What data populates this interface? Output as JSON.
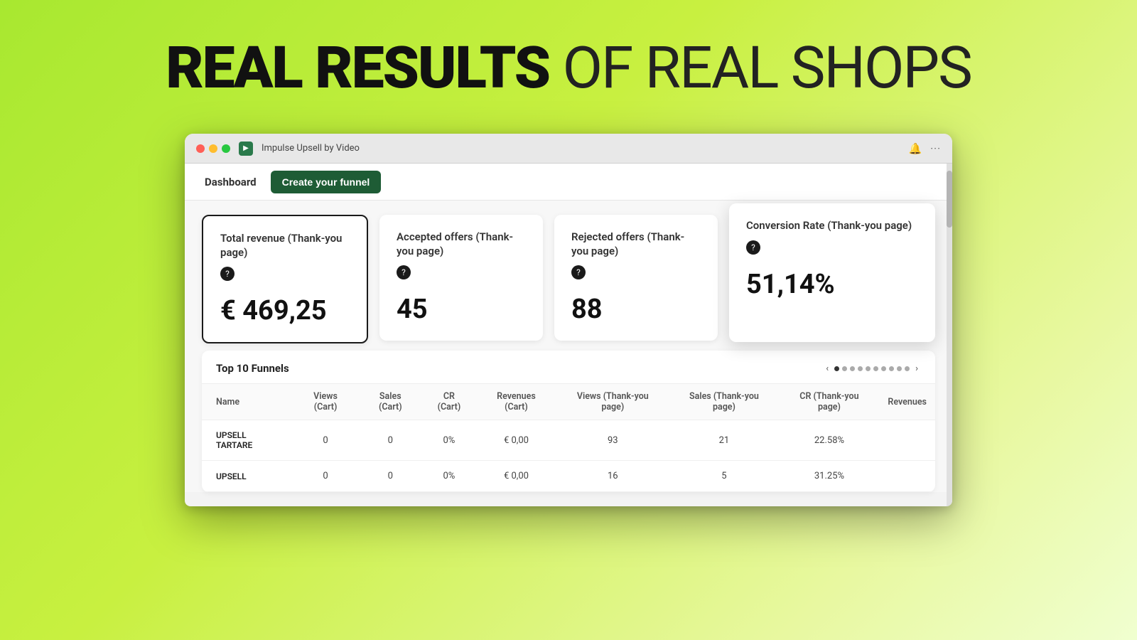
{
  "headline": {
    "bold": "REAL RESULTS",
    "light": "OF REAL SHOPS"
  },
  "browser": {
    "app_icon": "▶",
    "title": "Impulse Upsell by Video",
    "bell_icon": "🔔",
    "more_icon": "···"
  },
  "nav": {
    "dashboard_label": "Dashboard",
    "create_funnel_label": "Create your funnel"
  },
  "stats": {
    "cards": [
      {
        "title": "Total revenue (Thank-you page)",
        "help": "?",
        "value": "€ 469,25"
      },
      {
        "title": "Accepted offers (Thank-you page)",
        "help": "?",
        "value": "45"
      },
      {
        "title": "Rejected offers (Thank-you page)",
        "help": "?",
        "value": "88"
      }
    ],
    "conversion_card": {
      "title": "Conversion Rate (Thank-you page)",
      "help": "?",
      "value": "51,14%"
    }
  },
  "table": {
    "title": "Top 10 Funnels",
    "columns": [
      "Name",
      "Views (Cart)",
      "Sales (Cart)",
      "CR (Cart)",
      "Revenues (Cart)",
      "Views (Thank-you page)",
      "Sales (Thank-you page)",
      "CR (Thank-you page)",
      "Revenues"
    ],
    "rows": [
      {
        "name": "UPSELL TARTARE",
        "views_cart": "0",
        "sales_cart": "0",
        "cr_cart": "0%",
        "revenues_cart": "€ 0,00",
        "views_ty": "93",
        "sales_ty": "21",
        "cr_ty": "22.58%",
        "revenues": ""
      },
      {
        "name": "UPSELL",
        "views_cart": "0",
        "sales_cart": "0",
        "cr_cart": "0%",
        "revenues_cart": "€ 0,00",
        "views_ty": "16",
        "sales_ty": "5",
        "cr_ty": "31.25%",
        "revenues": ""
      }
    ],
    "pagination": {
      "dots": 10,
      "active_dot": 0
    }
  }
}
